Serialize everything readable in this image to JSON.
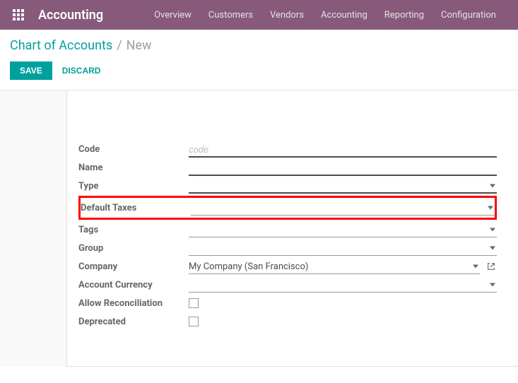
{
  "header": {
    "app_title": "Accounting",
    "menu": [
      "Overview",
      "Customers",
      "Vendors",
      "Accounting",
      "Reporting",
      "Configuration"
    ]
  },
  "breadcrumb": {
    "parent": "Chart of Accounts",
    "sep": "/",
    "current": "New"
  },
  "actions": {
    "save": "SAVE",
    "discard": "DISCARD"
  },
  "form": {
    "code_label": "Code",
    "code_placeholder": "code",
    "name_label": "Name",
    "type_label": "Type",
    "default_taxes_label": "Default Taxes",
    "tags_label": "Tags",
    "group_label": "Group",
    "company_label": "Company",
    "company_value": "My Company (San Francisco)",
    "currency_label": "Account Currency",
    "allow_reconciliation_label": "Allow Reconciliation",
    "deprecated_label": "Deprecated"
  }
}
